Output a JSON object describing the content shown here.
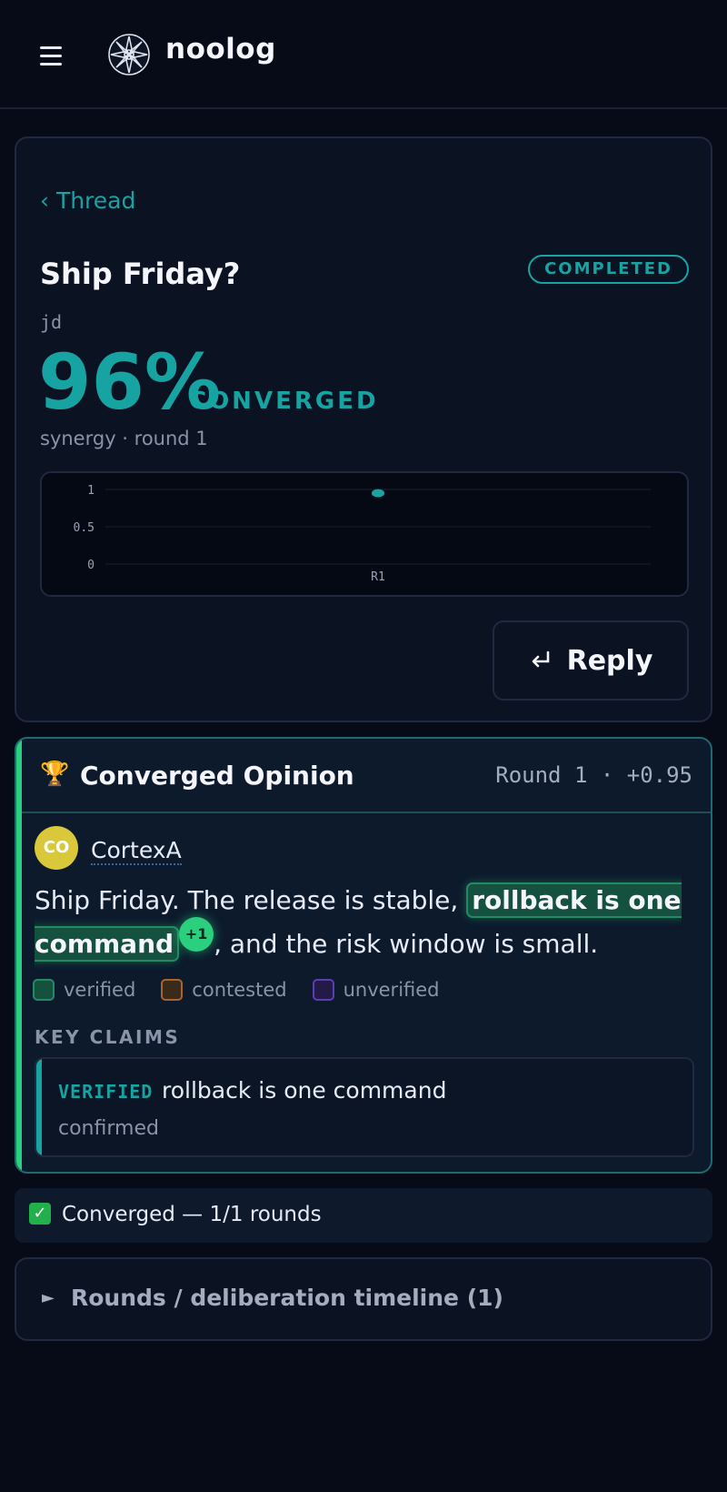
{
  "app": {
    "brand": "noolog"
  },
  "thread": {
    "back_label": "‹ Thread",
    "title": "Ship Friday?",
    "status": "COMPLETED",
    "author": "jd",
    "percent": "96%",
    "converged_word": "CONVERGED",
    "subline": "synergy · round 1",
    "reply_label": "Reply",
    "reply_icon": "return-arrow-icon"
  },
  "chart_data": {
    "type": "scatter",
    "categories": [
      "R1"
    ],
    "values": [
      0.95
    ],
    "ylim": [
      0,
      1
    ],
    "yticks": [
      "1",
      "0.5",
      "0"
    ],
    "grid": true,
    "color": "#17a3a2"
  },
  "opinion": {
    "title": "Converged Opinion",
    "meta": "Round 1 · +0.95",
    "trophy_icon": "trophy-icon",
    "agent_initials": "CO",
    "agent_name": "CortexA",
    "text_before": "Ship Friday. The release is stable, ",
    "highlight": "rollback is one command",
    "badge": "+1",
    "text_after": ", and the risk window is small.",
    "legend": {
      "verified": "verified",
      "contested": "contested",
      "unverified": "unverified"
    },
    "legend_colors": {
      "verified": "#238a63",
      "contested": "#a8642a",
      "unverified": "#5b3fb0"
    },
    "key_claims_label": "KEY CLAIMS",
    "claim": {
      "tag": "VERIFIED",
      "text": "rollback is one command",
      "note": "confirmed"
    }
  },
  "converged_bar": {
    "text": "Converged — 1/1 rounds"
  },
  "timeline": {
    "label": "Rounds / deliberation timeline (1)"
  }
}
